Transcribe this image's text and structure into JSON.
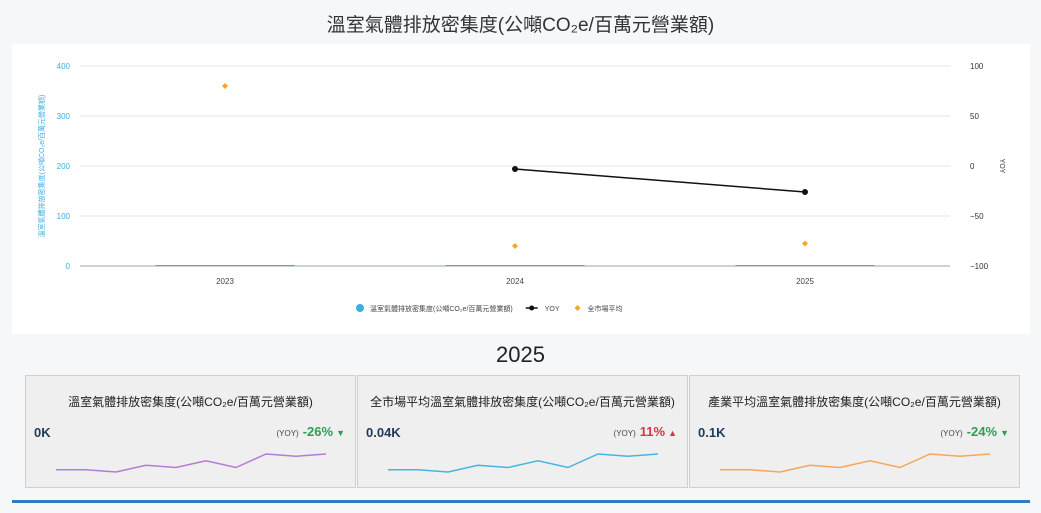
{
  "title": "溫室氣體排放密集度(公噸CO₂e/百萬元營業額)",
  "chart_data": {
    "type": "bar",
    "categories": [
      "2023",
      "2024",
      "2025"
    ],
    "series": [
      {
        "name": "溫室氣體排放密集度(公噸CO₂e/百萬元營業額)",
        "kind": "bar",
        "axis": "left",
        "values": [
          2,
          2,
          2
        ],
        "color": "#3eaee0"
      },
      {
        "name": "YOY",
        "kind": "line",
        "axis": "right",
        "values": [
          null,
          -3,
          -26
        ],
        "color": "#111111"
      },
      {
        "name": "全市場平均",
        "kind": "point",
        "axis": "left",
        "values": [
          360,
          40,
          45
        ],
        "color": "#f5a623"
      }
    ],
    "ylabel": "溫室氣體排放密集度(公噸CO₂e/百萬元營業額)",
    "ylabel_right": "YOY",
    "ylim": [
      0,
      400
    ],
    "ylim_right": [
      -100,
      100
    ],
    "yticks": [
      "400",
      "300",
      "200",
      "100",
      "0"
    ],
    "yticks_right": [
      "100",
      "50",
      "0",
      "−50",
      "−100"
    ],
    "grid": true,
    "legend_position": "bottom"
  },
  "year": "2025",
  "cards": [
    {
      "title": "溫室氣體排放密集度(公噸CO₂e/百萬元營業額)",
      "value": "0K",
      "yoy_label": "(YOY)",
      "yoy": "-26%",
      "yoy_arrow": "▼",
      "yoy_color": "#2e9e55",
      "spark_color": "#b57ad6",
      "spark": [
        3,
        3,
        2,
        5,
        4,
        7,
        4,
        10,
        9,
        10
      ]
    },
    {
      "title": "全市場平均溫室氣體排放密集度(公噸CO₂e/百萬元營業額)",
      "value": "0.04K",
      "yoy_label": "(YOY)",
      "yoy": "11%",
      "yoy_arrow": "▲",
      "yoy_color": "#d8324a",
      "spark_color": "#47b4e0",
      "spark": [
        3,
        3,
        2,
        5,
        4,
        7,
        4,
        10,
        9,
        10
      ]
    },
    {
      "title": "產業平均溫室氣體排放密集度(公噸CO₂e/百萬元營業額)",
      "value": "0.1K",
      "yoy_label": "(YOY)",
      "yoy": "-24%",
      "yoy_arrow": "▼",
      "yoy_color": "#2e9e55",
      "spark_color": "#f5a65b",
      "spark": [
        3,
        3,
        2,
        5,
        4,
        7,
        4,
        10,
        9,
        10
      ]
    }
  ]
}
